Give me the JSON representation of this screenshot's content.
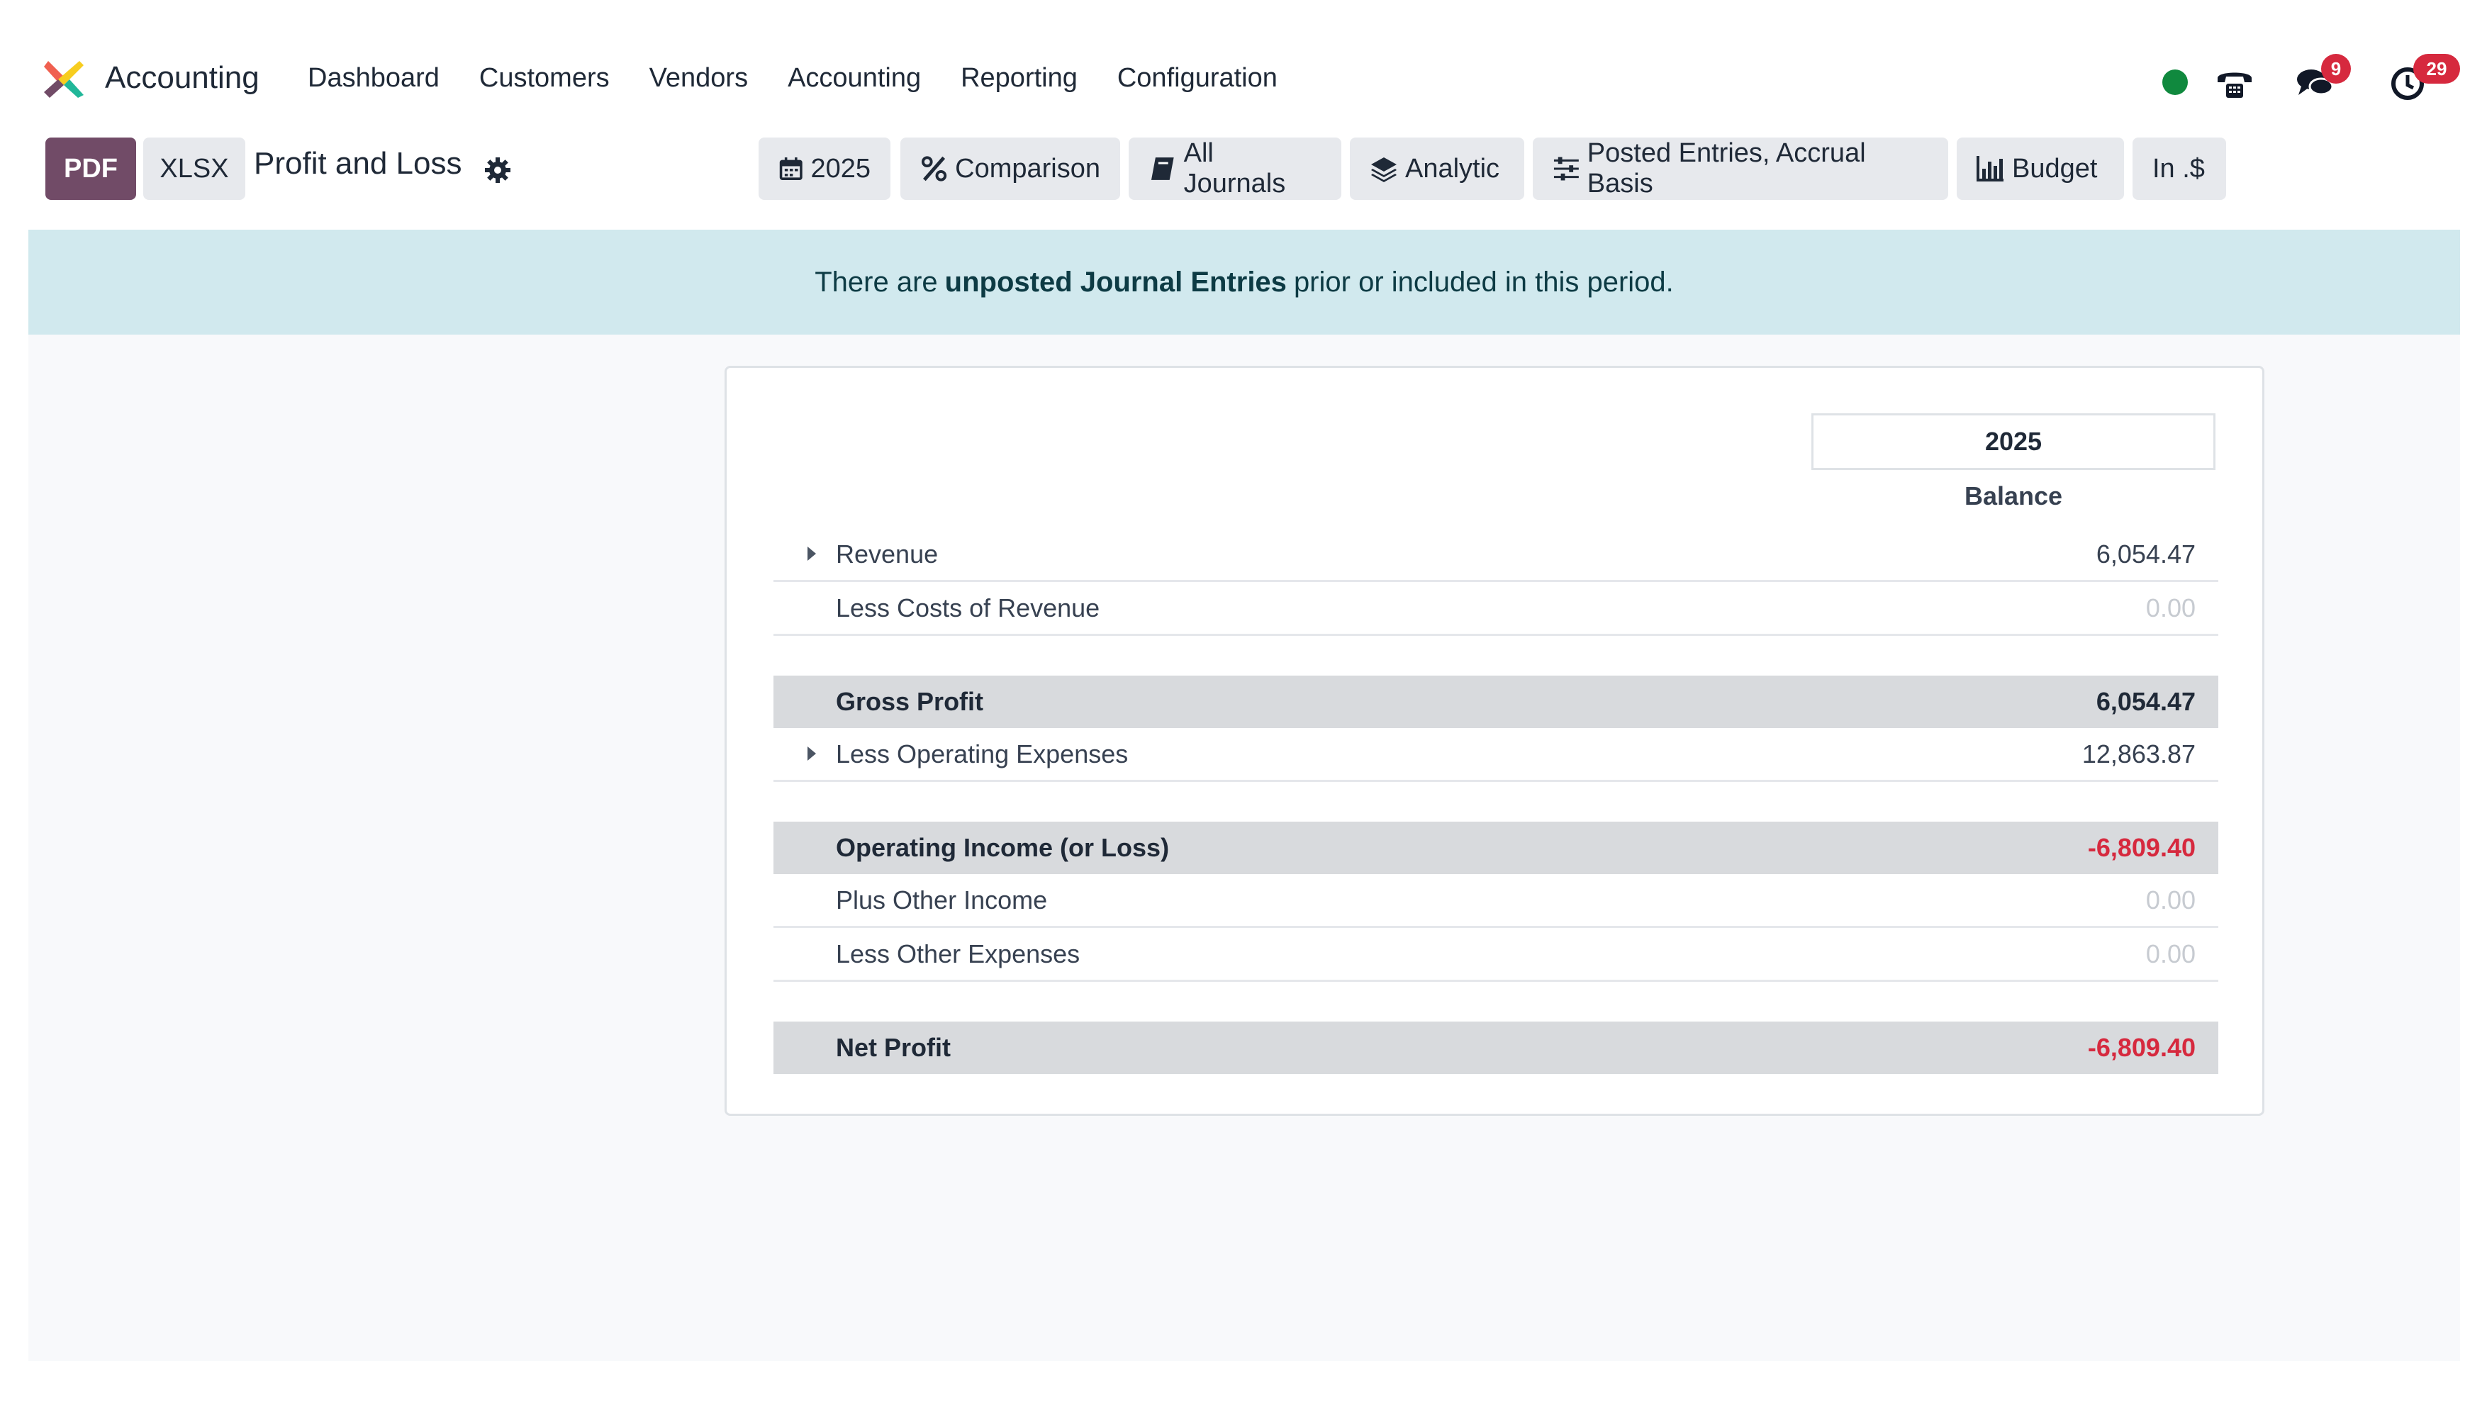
{
  "navbar": {
    "app_name": "Accounting",
    "menu": [
      "Dashboard",
      "Customers",
      "Vendors",
      "Accounting",
      "Reporting",
      "Configuration"
    ],
    "systray": {
      "presence_color": "#10893e",
      "chat_count": "9",
      "activity_count": "29"
    }
  },
  "control_panel": {
    "pdf_label": "PDF",
    "xlsx_label": "XLSX",
    "report_title": "Profit and Loss",
    "filters": {
      "date": "2025",
      "comparison": "Comparison",
      "journals": "All Journals",
      "analytic": "Analytic",
      "entries": "Posted Entries, Accrual Basis",
      "budget": "Budget",
      "currency": "In .$"
    }
  },
  "alert": {
    "prefix": "There are",
    "link": "unposted Journal Entries",
    "suffix": "prior or included in this period."
  },
  "report": {
    "column_header": "2025",
    "column_sub": "Balance",
    "rows": [
      {
        "label": "Revenue",
        "value": "6,054.47"
      },
      {
        "label": "Less Costs of Revenue",
        "value": "0.00"
      },
      {
        "label": "Gross Profit",
        "value": "6,054.47"
      },
      {
        "label": "Less Operating Expenses",
        "value": "12,863.87"
      },
      {
        "label": "Operating Income (or Loss)",
        "value": "-6,809.40"
      },
      {
        "label": "Plus Other Income",
        "value": "0.00"
      },
      {
        "label": "Less Other Expenses",
        "value": "0.00"
      },
      {
        "label": "Net Profit",
        "value": "-6,809.40"
      }
    ]
  },
  "colors": {
    "brand": "#714b67",
    "negative": "#d6293e",
    "alert_bg": "#d1e9ee"
  }
}
